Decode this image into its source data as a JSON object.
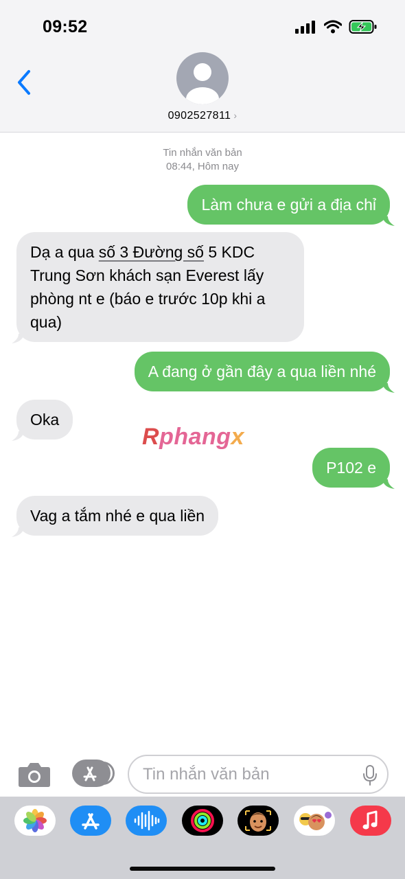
{
  "status_bar": {
    "time": "09:52"
  },
  "header": {
    "contact_name": "0902527811",
    "chevron": "›"
  },
  "conversation": {
    "meta_line1": "Tin nhắn văn bản",
    "meta_line2": "08:44, Hôm nay",
    "messages": [
      {
        "direction": "outgoing",
        "text": "Làm chưa e gửi a địa chỉ"
      },
      {
        "direction": "incoming",
        "lines": [
          "Dạ a qua ",
          "số 3 Đường số",
          " 5 KDC",
          "Trung Sơn khách sạn Everest lấy",
          "phòng nt e (báo e trước 10p khi a",
          "qua)"
        ]
      },
      {
        "direction": "outgoing",
        "text": "A đang ở gần đây a qua liền nhé"
      },
      {
        "direction": "incoming",
        "text": "Oka"
      },
      {
        "direction": "outgoing",
        "text": "P102 e"
      },
      {
        "direction": "incoming",
        "text": "Vag a tắm nhé e qua liền"
      }
    ]
  },
  "watermark": {
    "r": "R",
    "mid": "phang",
    "x": "x"
  },
  "input_bar": {
    "placeholder": "Tin nhắn văn bản"
  },
  "app_drawer": {
    "icons": [
      "photos-icon",
      "app-store-icon",
      "audio-message-icon",
      "activity-icon",
      "memoji-icon",
      "memoji-stickers-icon",
      "music-icon"
    ]
  },
  "colors": {
    "outgoing_bubble": "#65c466",
    "incoming_bubble": "#e9e9eb",
    "accent_blue": "#0a7aff"
  }
}
